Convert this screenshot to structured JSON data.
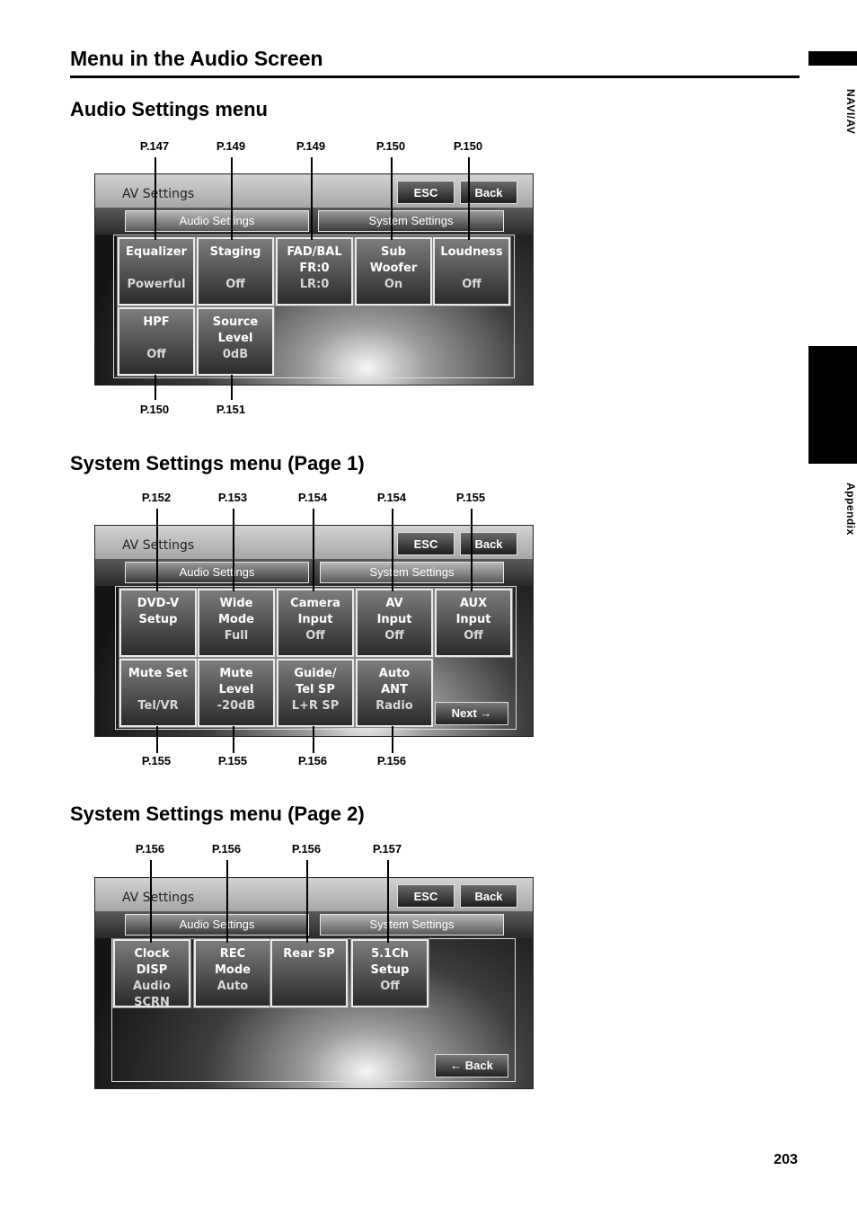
{
  "page_heading": "Menu in the Audio Screen",
  "side_tabs": {
    "top_label": "NAVI/AV",
    "bottom_label": "Appendix"
  },
  "page_number": "203",
  "screen_common": {
    "title": "AV Settings",
    "esc_label": "ESC",
    "back_label": "Back",
    "tab_audio": "Audio Settings",
    "tab_system": "System Settings"
  },
  "section1": {
    "title": "Audio Settings menu",
    "top_refs": [
      "P.147",
      "P.149",
      "P.149",
      "P.150",
      "P.150"
    ],
    "bottom_refs": [
      "P.150",
      "P.151"
    ],
    "tiles": [
      {
        "l1": "Equalizer",
        "l2": "",
        "l3": "Powerful"
      },
      {
        "l1": "Staging",
        "l2": "",
        "l3": "Off"
      },
      {
        "l1": "FAD/BAL",
        "l2": "FR:0",
        "l3": "LR:0"
      },
      {
        "l1": "Sub",
        "l2": "Woofer",
        "l3": "On"
      },
      {
        "l1": "Loudness",
        "l2": "",
        "l3": "Off"
      },
      {
        "l1": "HPF",
        "l2": "",
        "l3": "Off"
      },
      {
        "l1": "Source",
        "l2": "Level",
        "l3": "0dB"
      }
    ]
  },
  "section2": {
    "title": "System Settings menu (Page 1)",
    "top_refs": [
      "P.152",
      "P.153",
      "P.154",
      "P.154",
      "P.155"
    ],
    "bottom_refs": [
      "P.155",
      "P.155",
      "P.156",
      "P.156"
    ],
    "tiles": [
      {
        "l1": "DVD-V",
        "l2": "Setup",
        "l3": ""
      },
      {
        "l1": "Wide",
        "l2": "Mode",
        "l3": "Full"
      },
      {
        "l1": "Camera",
        "l2": "Input",
        "l3": "Off"
      },
      {
        "l1": "AV",
        "l2": "Input",
        "l3": "Off"
      },
      {
        "l1": "AUX",
        "l2": "Input",
        "l3": "Off"
      },
      {
        "l1": "Mute Set",
        "l2": "",
        "l3": "Tel/VR"
      },
      {
        "l1": "Mute",
        "l2": "Level",
        "l3": "-20dB"
      },
      {
        "l1": "Guide/",
        "l2": "Tel SP",
        "l3": "L+R SP"
      },
      {
        "l1": "Auto",
        "l2": "ANT",
        "l3": "Radio"
      }
    ],
    "next_label": "Next →"
  },
  "section3": {
    "title": "System Settings menu (Page 2)",
    "top_refs": [
      "P.156",
      "P.156",
      "P.156",
      "P.157"
    ],
    "tiles": [
      {
        "l1": "Clock",
        "l2": "DISP",
        "l3": "Audio SCRN"
      },
      {
        "l1": "REC",
        "l2": "Mode",
        "l3": "Auto"
      },
      {
        "l1": "Rear SP",
        "l2": "",
        "l3": ""
      },
      {
        "l1": "5.1Ch",
        "l2": "Setup",
        "l3": "Off"
      }
    ],
    "back_label": "← Back"
  }
}
